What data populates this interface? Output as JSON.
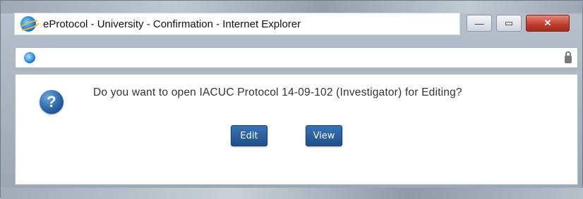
{
  "window": {
    "title": "eProtocol - University - Confirmation - Internet Explorer",
    "controls": {
      "minimize": "—",
      "maximize": "▭",
      "close": "✕"
    }
  },
  "address_bar": {
    "url": ""
  },
  "dialog": {
    "icon": "question-icon",
    "message": "Do you want to open IACUC Protocol 14-09-102 (Investigator) for Editing?",
    "buttons": {
      "edit": "Edit",
      "view": "View"
    }
  },
  "colors": {
    "button_bg": "#2a5c9c",
    "close_button": "#c0392b",
    "question_icon": "#2a64a8"
  }
}
